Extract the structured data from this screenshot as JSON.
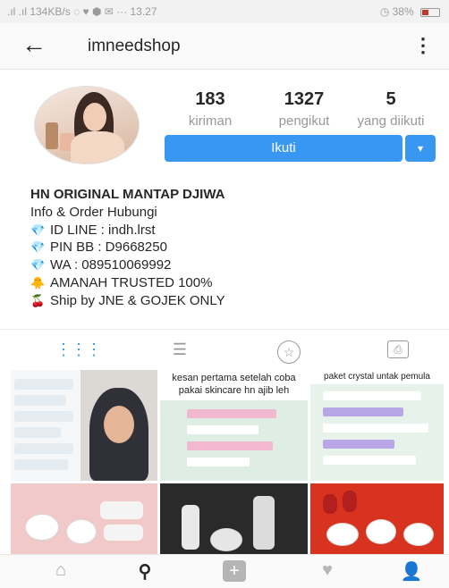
{
  "status_bar": {
    "left": ".ıl .ıl 134KB/s ◌ ♥ ⬢ ✉ ··· 13.27",
    "right": "◷ 38%"
  },
  "header": {
    "back_icon": "back-arrow-icon",
    "username": "imneedshop",
    "more_icon": "more-vertical-icon"
  },
  "profile": {
    "stats": [
      {
        "value": "183",
        "label": "kiriman"
      },
      {
        "value": "1327",
        "label": "pengikut"
      },
      {
        "value": "5",
        "label": "yang diikuti"
      }
    ],
    "follow_label": "Ikuti",
    "dropdown_icon": "▾",
    "accent_color": "#3897f0"
  },
  "bio": {
    "name": "HN ORIGINAL MANTAP DJIWA",
    "lines": [
      {
        "icon": "",
        "text": "Info & Order Hubungi"
      },
      {
        "icon": "💎",
        "text": "ID LINE : indh.lrst"
      },
      {
        "icon": "💎",
        "text": "PIN BB : D9668250"
      },
      {
        "icon": "💎",
        "text": "WA : 089510069992"
      },
      {
        "icon": "🐥",
        "text": "AMANAH TRUSTED 100%"
      },
      {
        "icon": "🍒",
        "text": "Ship by JNE & GOJEK ONLY"
      }
    ]
  },
  "tabs": {
    "grid": "⋮⋮⋮",
    "list": "☰",
    "star": "☆",
    "tag": "⎙"
  },
  "posts": {
    "post2_caption": "kesan pertama setelah coba pakai skincare hn ajib leh",
    "post3_caption": "paket crystal untak pemula"
  },
  "bottom_nav": {
    "home": "⌂",
    "search": "⚲",
    "add": "+",
    "heart": "♥",
    "profile": "👤"
  }
}
